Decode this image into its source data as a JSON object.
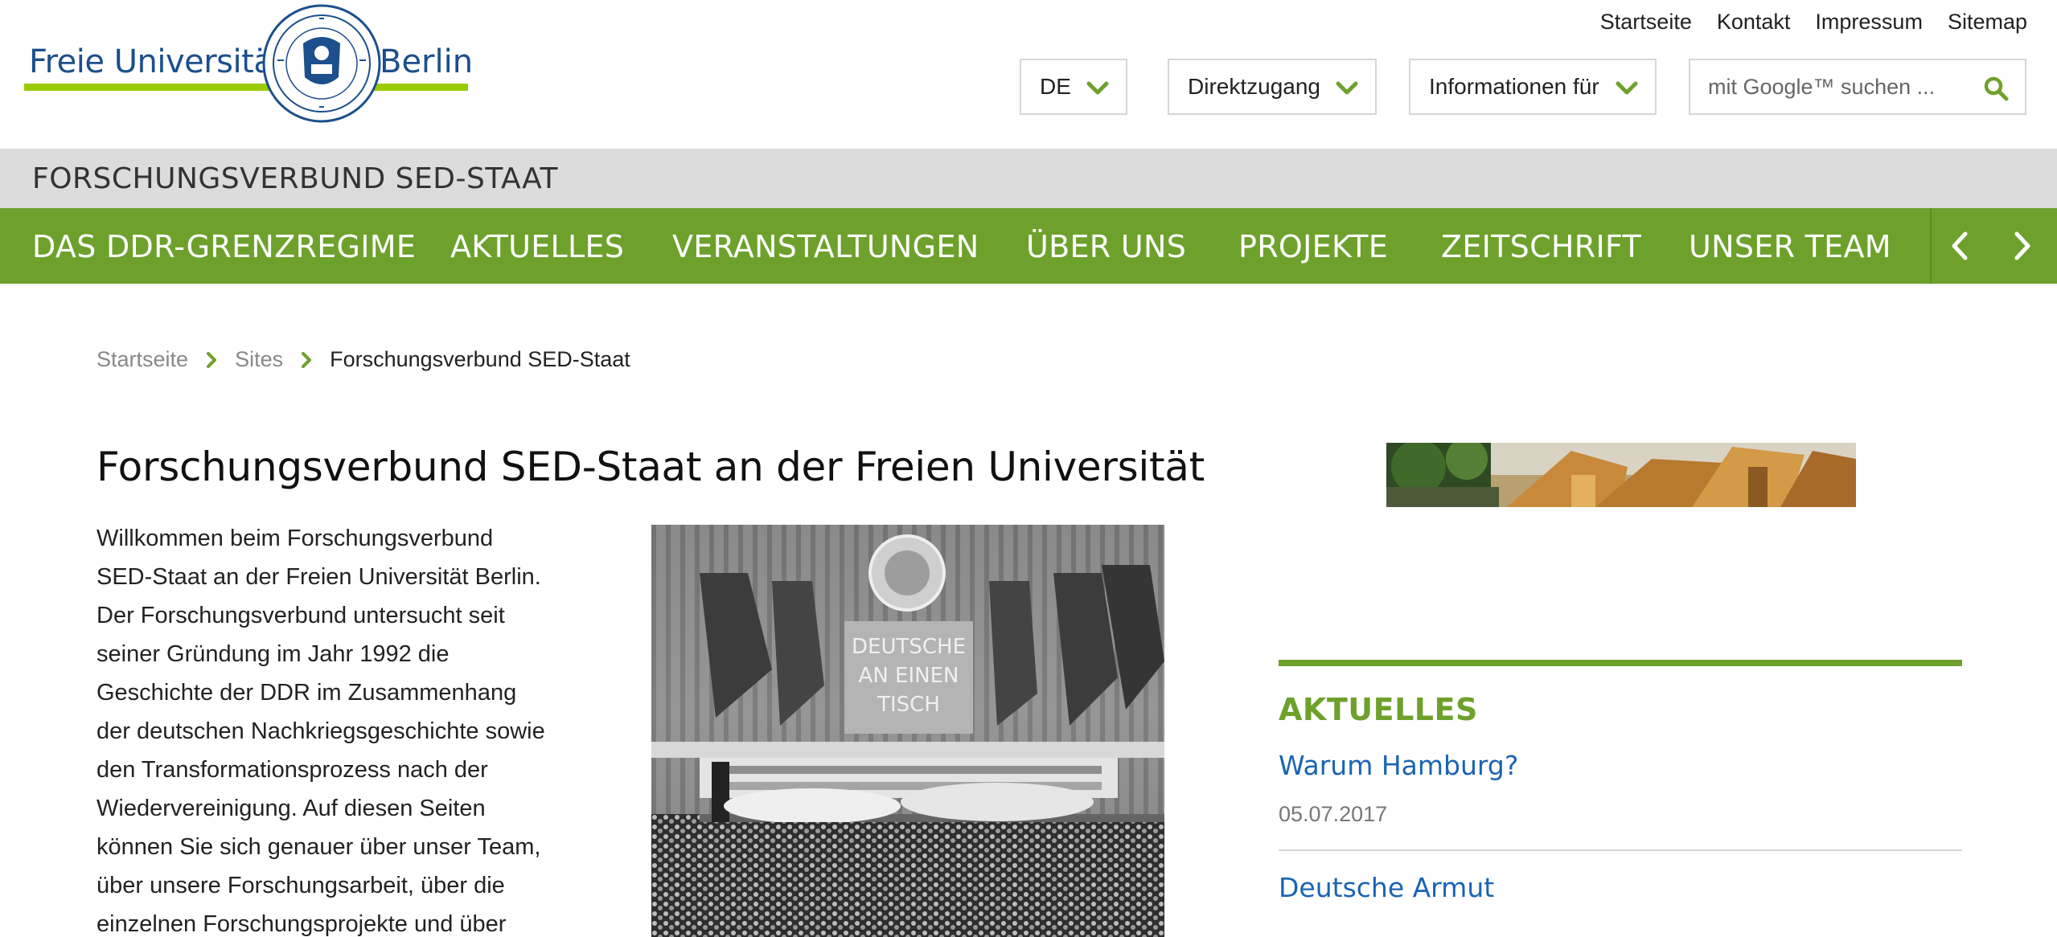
{
  "logo": {
    "left_text": "Freie Universität",
    "right_text": "Berlin"
  },
  "service_links": [
    "Startseite",
    "Kontakt",
    "Impressum",
    "Sitemap"
  ],
  "header_controls": {
    "language": "DE",
    "direktzugang": "Direktzugang",
    "informationen": "Informationen für",
    "search_placeholder": "mit Google™ suchen ..."
  },
  "site_title": "FORSCHUNGSVERBUND SED-STAAT",
  "main_nav": [
    "DAS DDR-GRENZREGIME",
    "AKTUELLES",
    "VERANSTALTUNGEN",
    "ÜBER UNS",
    "PROJEKTE",
    "ZEITSCHRIFT",
    "UNSER TEAM"
  ],
  "breadcrumb": [
    "Startseite",
    "Sites",
    "Forschungsverbund SED-Staat"
  ],
  "content": {
    "title": "Forschungsverbund SED-Staat an der Freien Universität",
    "intro_lines": [
      "Willkommen beim Forschungsverbund",
      "SED-Staat an der Freien Universität Berlin.",
      "Der Forschungsverbund untersucht seit",
      "seiner Gründung im Jahr 1992 die",
      "Geschichte der DDR im Zusammenhang",
      "der deutschen Nachkriegsgeschichte sowie",
      "den Transformationsprozess nach der",
      "Wiedervereinigung. Auf diesen Seiten",
      "können Sie sich genauer über unser Team,",
      "über unsere Forschungsarbeit, über die",
      "einzelnen Forschungsprojekte und über"
    ],
    "image_banner_text": [
      "DEUTSCHE",
      "AN EINEN",
      "TISCH"
    ]
  },
  "sidebar": {
    "news_heading": "AKTUELLES",
    "news": [
      {
        "title": "Warum Hamburg?",
        "date": "05.07.2017"
      },
      {
        "title": "Deutsche Armut",
        "date": ""
      }
    ]
  },
  "colors": {
    "brand_green": "#6ea12c",
    "logo_blue": "#1c4f8c",
    "link_blue": "#1a64b4",
    "title_bar_gray": "#dcdcdc"
  }
}
